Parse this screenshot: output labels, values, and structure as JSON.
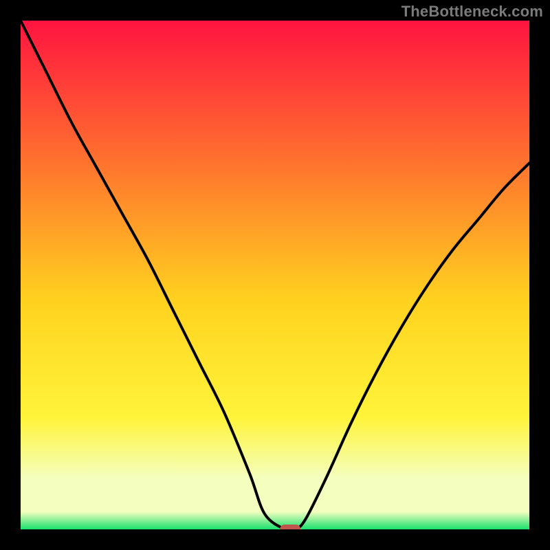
{
  "watermark": "TheBottleneck.com",
  "colors": {
    "frame": "#000000",
    "curve": "#000000",
    "marker_fill": "#c1554d",
    "gradient_top": "#ff1440",
    "gradient_mid_upper": "#ff7a2d",
    "gradient_mid": "#ffd21f",
    "gradient_mid_lower": "#fff43a",
    "gradient_pale": "#f4ffbf",
    "gradient_green": "#18e06d"
  },
  "chart_data": {
    "type": "line",
    "title": "",
    "xlabel": "",
    "ylabel": "",
    "xlim": [
      0,
      100
    ],
    "ylim": [
      0,
      100
    ],
    "x": [
      0,
      5,
      10,
      15,
      20,
      25,
      30,
      35,
      40,
      45,
      48,
      52,
      54,
      56,
      60,
      65,
      70,
      75,
      80,
      85,
      90,
      95,
      100
    ],
    "values": [
      100,
      90,
      80,
      71,
      62,
      53,
      43,
      33,
      23,
      11,
      3,
      0,
      0,
      2,
      10,
      21,
      31,
      40,
      48,
      55,
      61,
      67,
      72
    ],
    "minimum_marker": {
      "x": 53,
      "y": 0
    },
    "gradient_stops": [
      {
        "offset": 0,
        "y": 100
      },
      {
        "offset": 0.3,
        "y": 70
      },
      {
        "offset": 0.55,
        "y": 45
      },
      {
        "offset": 0.78,
        "y": 22
      },
      {
        "offset": 0.9,
        "y": 10
      },
      {
        "offset": 0.965,
        "y": 3.5
      },
      {
        "offset": 1.0,
        "y": 0
      }
    ]
  }
}
